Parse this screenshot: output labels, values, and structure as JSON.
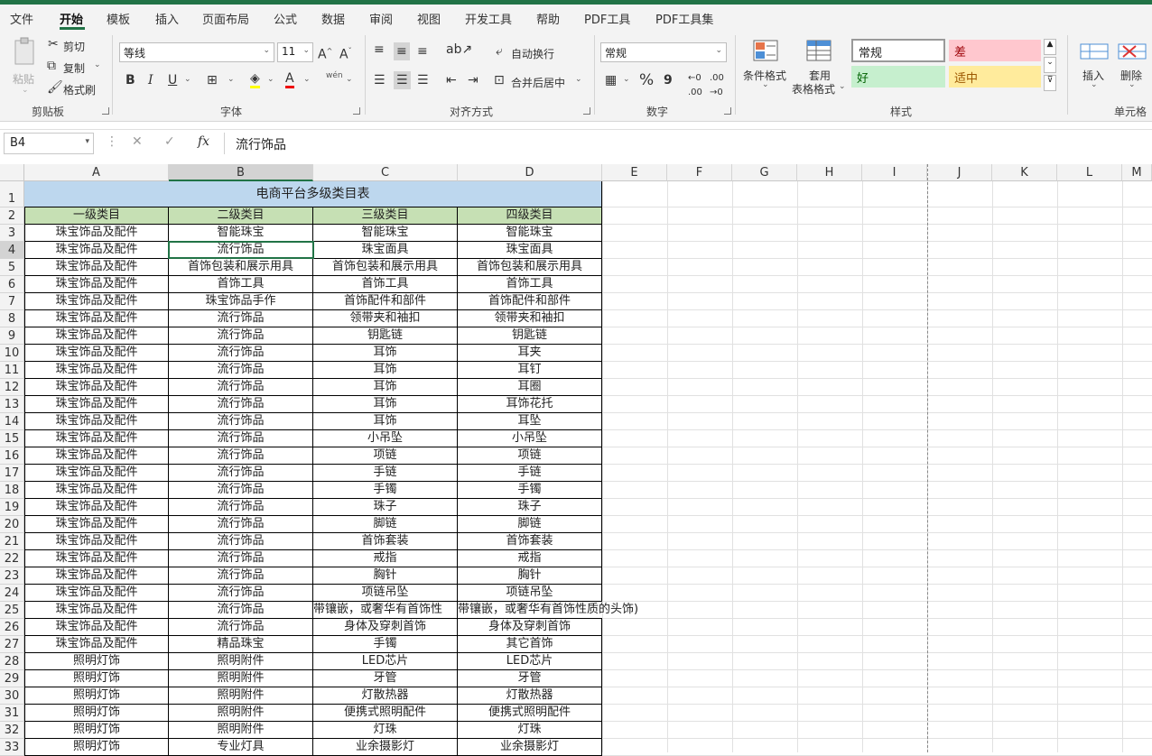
{
  "menu": {
    "items": [
      "文件",
      "开始",
      "模板",
      "插入",
      "页面布局",
      "公式",
      "数据",
      "审阅",
      "视图",
      "开发工具",
      "帮助",
      "PDF工具",
      "PDF工具集"
    ],
    "active_index": 1
  },
  "ribbon": {
    "clipboard": {
      "paste": "粘贴",
      "cut": "剪切",
      "copy": "复制",
      "format_painter": "格式刷",
      "label": "剪贴板"
    },
    "font": {
      "name": "等线",
      "size": "11",
      "bold": "B",
      "italic": "I",
      "underline": "U",
      "label": "字体",
      "phonetic": "wén"
    },
    "alignment": {
      "wrap": "自动换行",
      "merge": "合并后居中",
      "label": "对齐方式"
    },
    "number": {
      "format": "常规",
      "percent": "%",
      "comma": "9",
      "label": "数字"
    },
    "styles": {
      "conditional": "条件格式",
      "table": "套用",
      "table2": "表格格式",
      "normal": "常规",
      "bad": "差",
      "good": "好",
      "neutral": "适中",
      "label": "样式"
    },
    "cells": {
      "insert": "插入",
      "delete": "删除",
      "label": "单元格"
    }
  },
  "formula_bar": {
    "name_box": "B4",
    "fx": "fx",
    "content": "流行饰品"
  },
  "sheet": {
    "columns": [
      "A",
      "B",
      "C",
      "D",
      "E",
      "F",
      "G",
      "H",
      "I",
      "J",
      "K",
      "L",
      "M"
    ],
    "selected_column": "B",
    "title": "电商平台多级类目表",
    "headers": [
      "一级类目",
      "二级类目",
      "三级类目",
      "四级类目"
    ],
    "rows": [
      [
        "珠宝饰品及配件",
        "智能珠宝",
        "智能珠宝",
        "智能珠宝"
      ],
      [
        "珠宝饰品及配件",
        "流行饰品",
        "珠宝面具",
        "珠宝面具"
      ],
      [
        "珠宝饰品及配件",
        "首饰包装和展示用具",
        "首饰包装和展示用具",
        "首饰包装和展示用具"
      ],
      [
        "珠宝饰品及配件",
        "首饰工具",
        "首饰工具",
        "首饰工具"
      ],
      [
        "珠宝饰品及配件",
        "珠宝饰品手作",
        "首饰配件和部件",
        "首饰配件和部件"
      ],
      [
        "珠宝饰品及配件",
        "流行饰品",
        "领带夹和袖扣",
        "领带夹和袖扣"
      ],
      [
        "珠宝饰品及配件",
        "流行饰品",
        "钥匙链",
        "钥匙链"
      ],
      [
        "珠宝饰品及配件",
        "流行饰品",
        "耳饰",
        "耳夹"
      ],
      [
        "珠宝饰品及配件",
        "流行饰品",
        "耳饰",
        "耳钉"
      ],
      [
        "珠宝饰品及配件",
        "流行饰品",
        "耳饰",
        "耳圈"
      ],
      [
        "珠宝饰品及配件",
        "流行饰品",
        "耳饰",
        "耳饰花托"
      ],
      [
        "珠宝饰品及配件",
        "流行饰品",
        "耳饰",
        "耳坠"
      ],
      [
        "珠宝饰品及配件",
        "流行饰品",
        "小吊坠",
        "小吊坠"
      ],
      [
        "珠宝饰品及配件",
        "流行饰品",
        "项链",
        "项链"
      ],
      [
        "珠宝饰品及配件",
        "流行饰品",
        "手链",
        "手链"
      ],
      [
        "珠宝饰品及配件",
        "流行饰品",
        "手镯",
        "手镯"
      ],
      [
        "珠宝饰品及配件",
        "流行饰品",
        "珠子",
        "珠子"
      ],
      [
        "珠宝饰品及配件",
        "流行饰品",
        "脚链",
        "脚链"
      ],
      [
        "珠宝饰品及配件",
        "流行饰品",
        "首饰套装",
        "首饰套装"
      ],
      [
        "珠宝饰品及配件",
        "流行饰品",
        "戒指",
        "戒指"
      ],
      [
        "珠宝饰品及配件",
        "流行饰品",
        "胸针",
        "胸针"
      ],
      [
        "珠宝饰品及配件",
        "流行饰品",
        "项链吊坠",
        "项链吊坠"
      ],
      [
        "珠宝饰品及配件",
        "流行饰品",
        "带镶嵌，或奢华有首饰性",
        "带镶嵌，或奢华有首饰性质的头饰)"
      ],
      [
        "珠宝饰品及配件",
        "流行饰品",
        "身体及穿刺首饰",
        "身体及穿刺首饰"
      ],
      [
        "珠宝饰品及配件",
        "精品珠宝",
        "手镯",
        "其它首饰"
      ],
      [
        "照明灯饰",
        "照明附件",
        "LED芯片",
        "LED芯片"
      ],
      [
        "照明灯饰",
        "照明附件",
        "牙管",
        "牙管"
      ],
      [
        "照明灯饰",
        "照明附件",
        "灯散热器",
        "灯散热器"
      ],
      [
        "照明灯饰",
        "照明附件",
        "便携式照明配件",
        "便携式照明配件"
      ],
      [
        "照明灯饰",
        "照明附件",
        "灯珠",
        "灯珠"
      ],
      [
        "照明灯饰",
        "专业灯具",
        "业余摄影灯",
        "业余摄影灯"
      ]
    ]
  }
}
